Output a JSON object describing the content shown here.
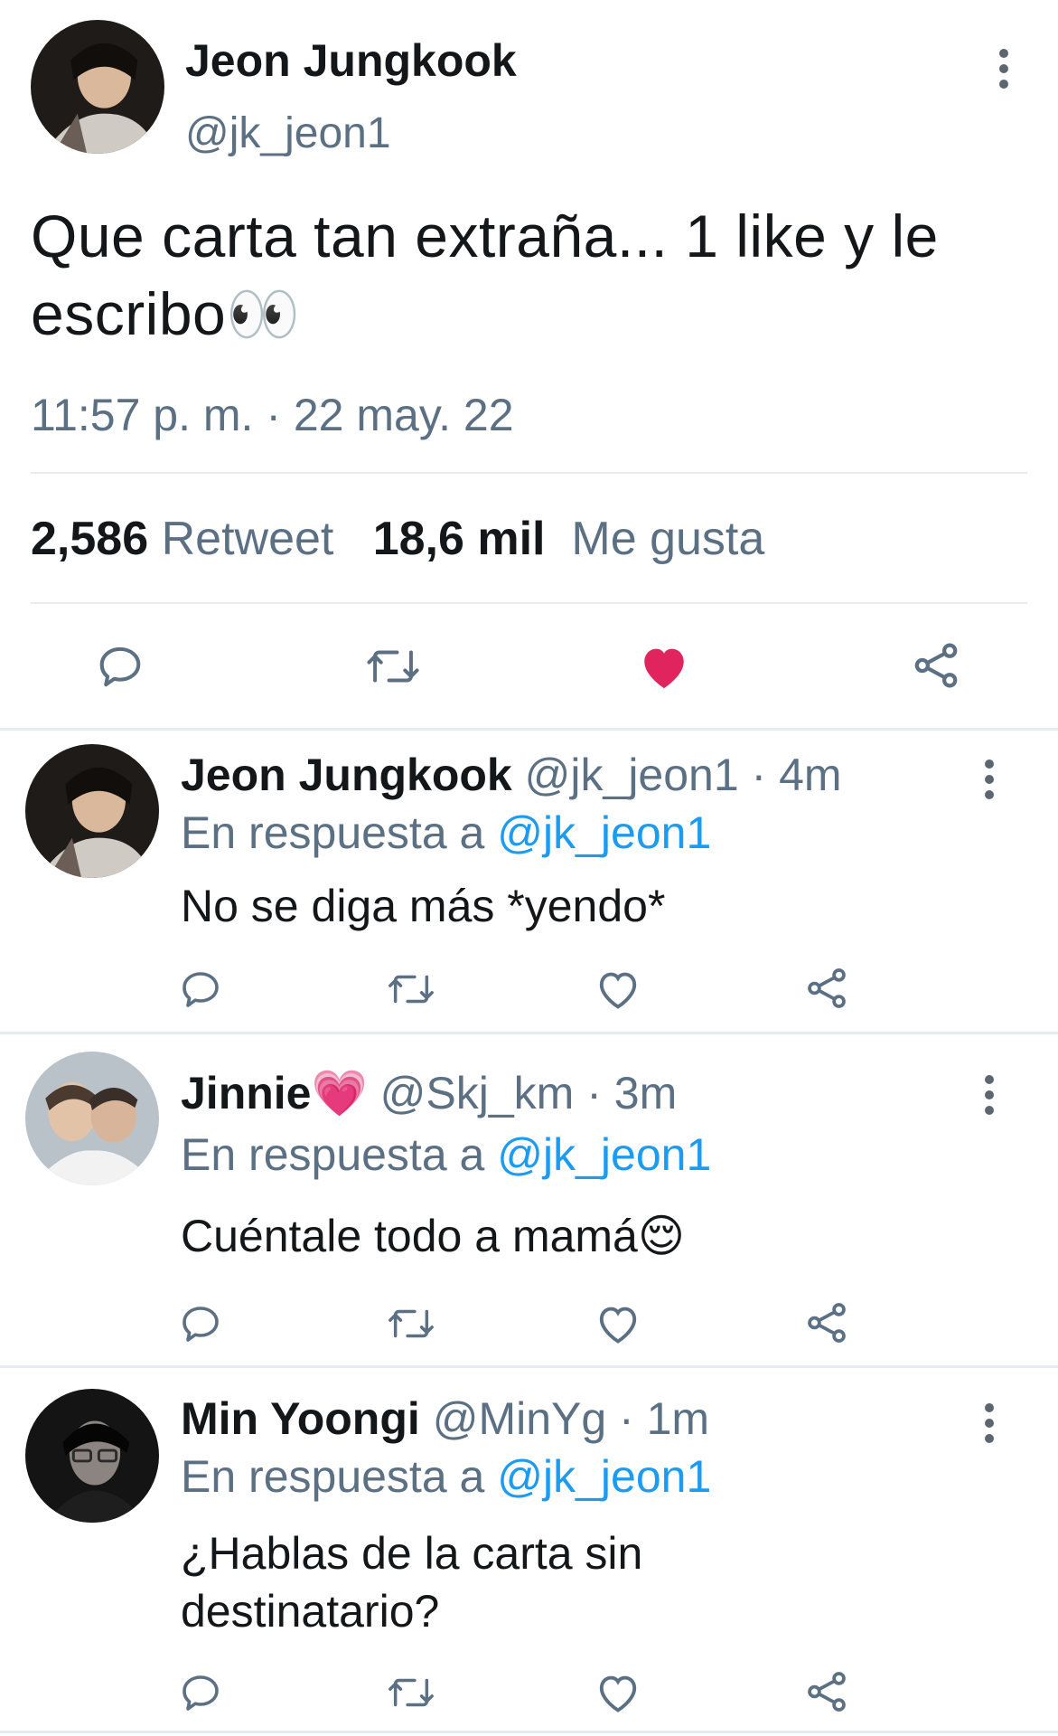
{
  "main_tweet": {
    "name": "Jeon Jungkook",
    "handle": "@jk_jeon1",
    "text": "Que carta tan extraña... 1 like y le escribo👀",
    "timestamp": "11:57 p. m. · 22 may. 22",
    "retweets_count": "2,586",
    "retweets_label": "Retweet",
    "likes_count": "18,6 mil",
    "likes_label": "Me gusta",
    "liked": true
  },
  "replies": [
    {
      "name": "Jeon Jungkook",
      "handle_time": "@jk_jeon1 · 4m",
      "reply_prefix": "En respuesta a",
      "reply_mention": "@jk_jeon1",
      "text": "No se diga más *yendo*"
    },
    {
      "name": "Jinnie💗",
      "handle_time": "@Skj_km · 3m",
      "reply_prefix": "En respuesta a",
      "reply_mention": "@jk_jeon1",
      "text": "Cuéntale todo a mamá😌"
    },
    {
      "name": "Min Yoongi",
      "handle_time": "@MinYg · 1m",
      "reply_prefix": "En respuesta a",
      "reply_mention": "@jk_jeon1",
      "text": "¿Hablas de la carta sin destinatario?"
    }
  ],
  "icons": {
    "reply": "speech-bubble-icon",
    "retweet": "retweet-arrows-icon",
    "like": "heart-icon",
    "share": "share-nodes-icon",
    "more": "vertical-dots-icon"
  },
  "colors": {
    "like_red": "#e0245e",
    "mention_blue": "#1d9bf0",
    "secondary_gray": "#5b7083",
    "divider": "#e6ecf0"
  }
}
